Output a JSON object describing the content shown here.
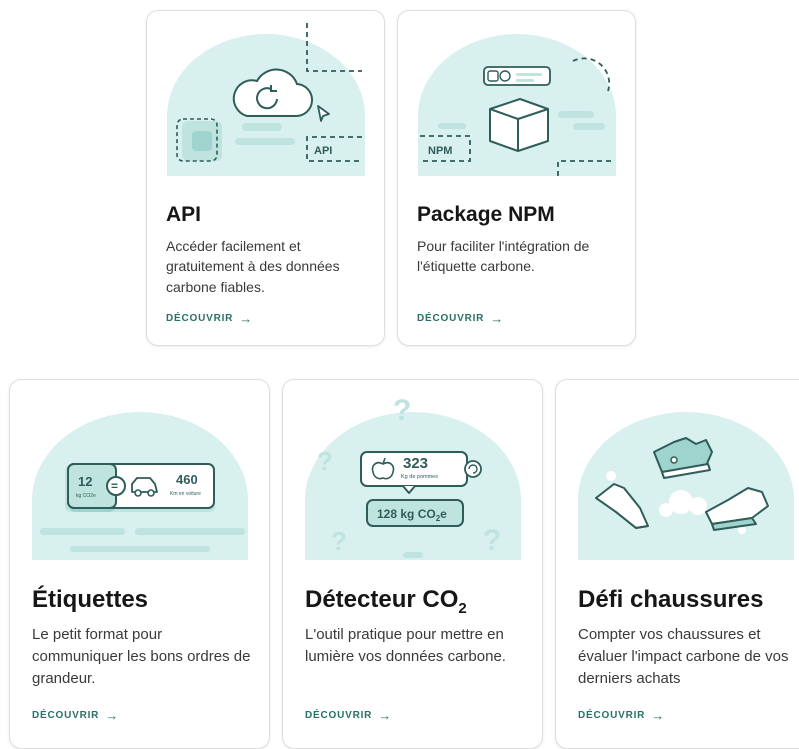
{
  "colors": {
    "card_border": "#dedede",
    "blob": "#d8f0ee",
    "ink": "#2e5d5a",
    "accent": "#2a6f68",
    "shape_light": "#bfe3df",
    "shape_mid": "#9fd3cd"
  },
  "cards": [
    {
      "title": "API",
      "description": "Accéder facilement et gratuitement à des données carbone fiables.",
      "cta": "DÉCOUVRIR",
      "cta_arrow": "→",
      "illustration": {
        "icon": "cloud-sync-icon",
        "badge": "API"
      }
    },
    {
      "title": "Package NPM",
      "description": "Pour faciliter l'intégration de l'étiquette carbone.",
      "cta": "DÉCOUVRIR",
      "cta_arrow": "→",
      "illustration": {
        "icon": "package-box-icon",
        "badge": "NPM"
      }
    },
    {
      "title": "Étiquettes",
      "description": "Le petit format pour communiquer les bons ordres de grandeur.",
      "cta": "DÉCOUVRIR",
      "cta_arrow": "→",
      "illustration": {
        "icon": "car-icon",
        "left_value": "12",
        "left_unit": "kg CO2e",
        "equals": "=",
        "right_value": "460",
        "right_unit": "Km en voiture"
      }
    },
    {
      "title_main": "Détecteur CO",
      "title_sub": "2",
      "description": "L'outil pratique pour mettre en lumière vos données carbone.",
      "cta": "DÉCOUVRIR",
      "cta_arrow": "→",
      "illustration": {
        "icon": "apple-icon",
        "value": "323",
        "unit": "Kg de pommes",
        "result_main": "128 kg CO",
        "result_sub": "2",
        "result_suffix": "e",
        "decor": "?"
      }
    },
    {
      "title": "Défi chaussures",
      "description": "Compter vos chaussures et évaluer l'impact carbone de vos derniers achats",
      "cta": "DÉCOUVRIR",
      "cta_arrow": "→",
      "illustration": {
        "icon": "sneakers-icon"
      }
    }
  ]
}
